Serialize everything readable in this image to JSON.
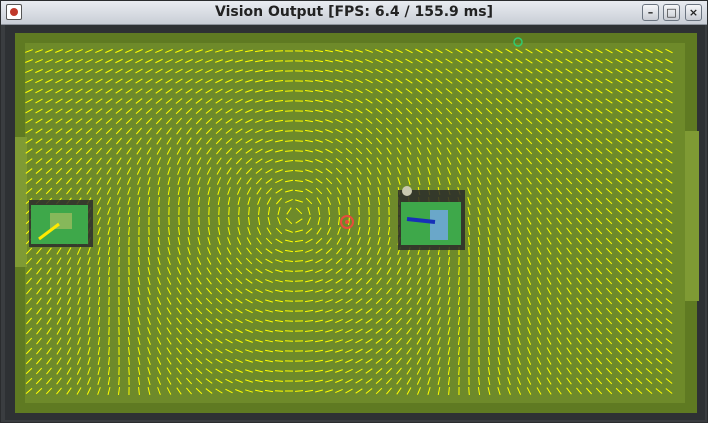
{
  "window": {
    "title": "Vision Output [FPS: 6.4 / 155.9 ms]",
    "buttons": {
      "minimize": "–",
      "maximize": "□",
      "close": "×"
    }
  },
  "view": {
    "field_color": "#6e8a2a",
    "vector_color": "#ffff00",
    "robots": [
      {
        "name": "robot-left",
        "color": "#3ea84a"
      },
      {
        "name": "robot-right",
        "color": "#3ea84a"
      }
    ],
    "ball_color": "#e74c3c",
    "target_marker_color": "#2ecc71"
  }
}
